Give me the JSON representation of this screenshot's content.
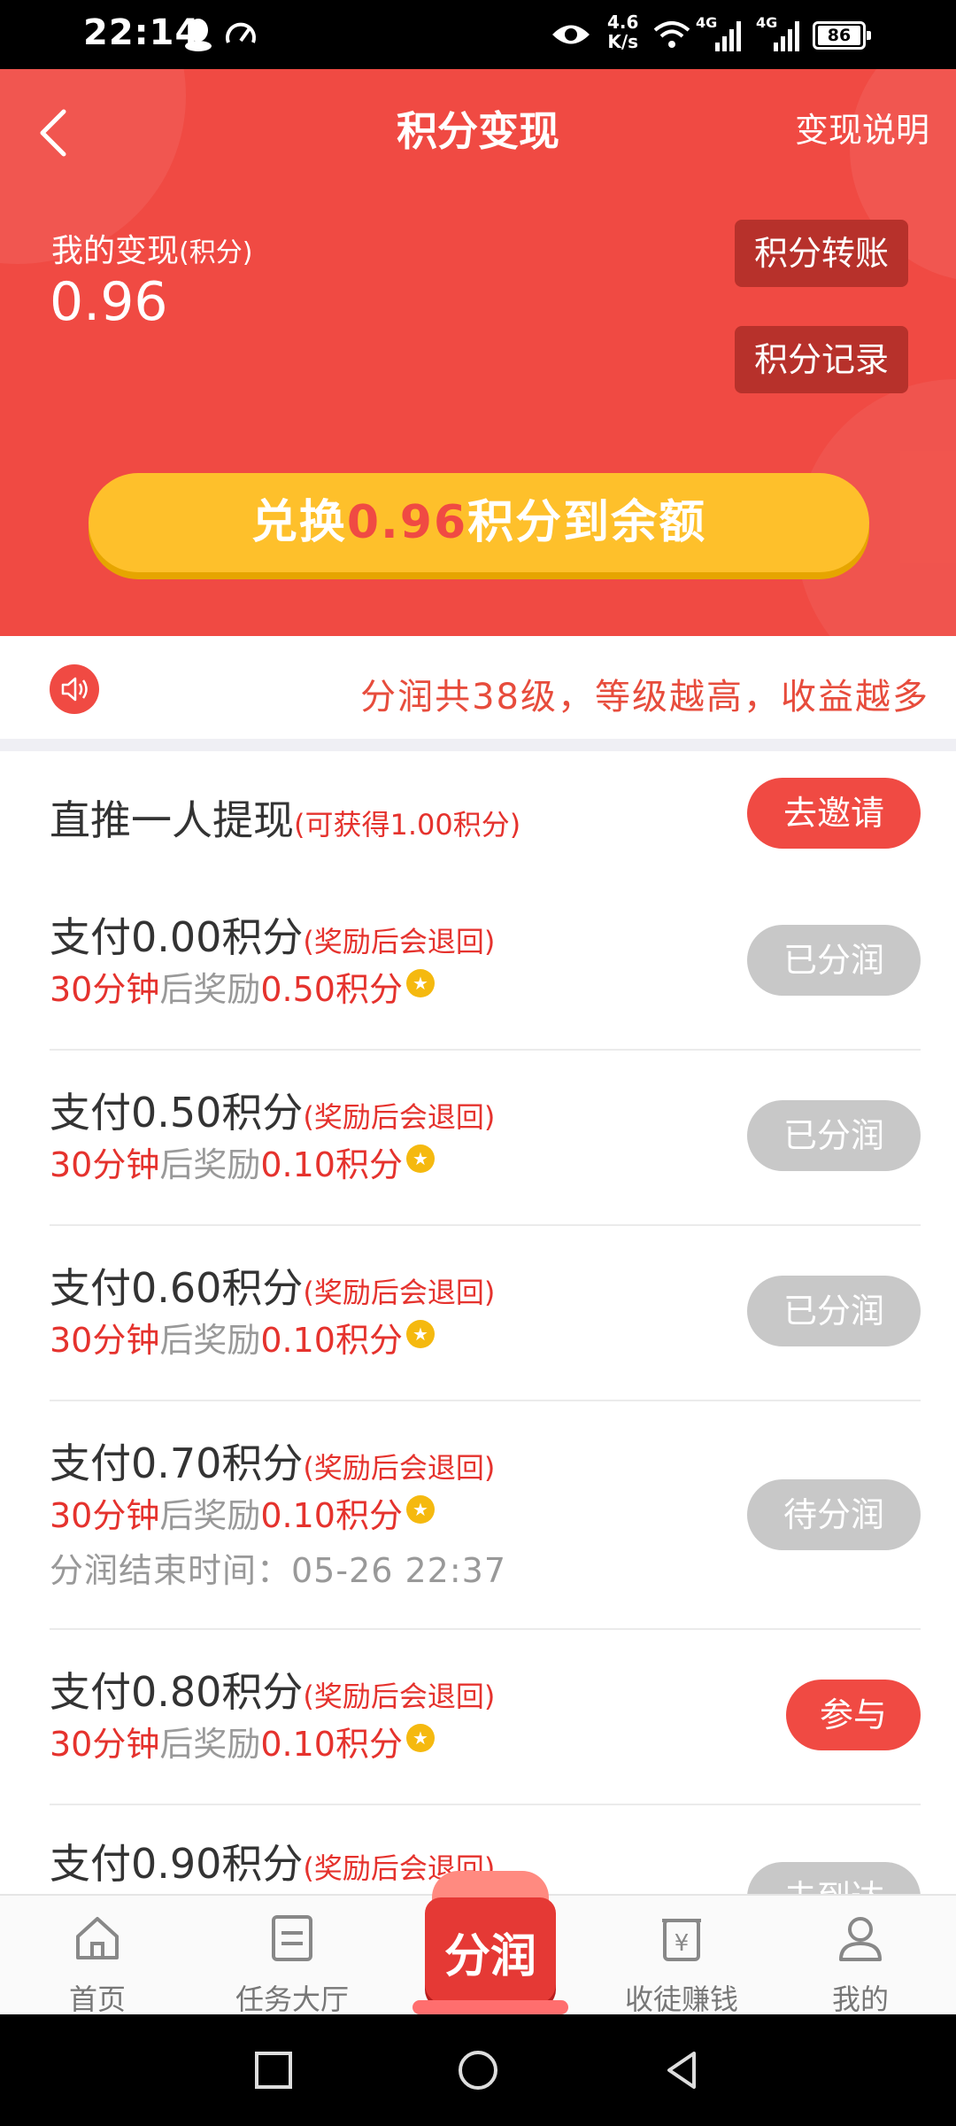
{
  "status_bar": {
    "time": "22:14",
    "net_speed_value": "4.6",
    "net_speed_unit": "K/s",
    "signal_1_label": "4G",
    "signal_2_label": "4G",
    "battery": "86"
  },
  "header": {
    "title": "积分变现",
    "help_link": "变现说明",
    "my_label": "我的变现",
    "my_label_unit": "(积分)",
    "my_value": "0.96",
    "transfer_button": "积分转账",
    "records_button": "积分记录",
    "exchange_prefix": "兑换",
    "exchange_amount": "0.96",
    "exchange_suffix": "积分到余额"
  },
  "notice": {
    "text": "分润共38级，等级越高，收益越多"
  },
  "tasks": [
    {
      "title": "直推一人提现",
      "note": "(可获得1.00积分)",
      "button": "去邀请"
    },
    {
      "title": "支付0.00积分",
      "note": "(奖励后会退回)",
      "sub_red1": "30分钟",
      "sub_gray": "后奖励",
      "sub_red2": "0.50积分",
      "button": "已分润"
    },
    {
      "title": "支付0.50积分",
      "note": "(奖励后会退回)",
      "sub_red1": "30分钟",
      "sub_gray": "后奖励",
      "sub_red2": "0.10积分",
      "button": "已分润"
    },
    {
      "title": "支付0.60积分",
      "note": "(奖励后会退回)",
      "sub_red1": "30分钟",
      "sub_gray": "后奖励",
      "sub_red2": "0.10积分",
      "button": "已分润"
    },
    {
      "title": "支付0.70积分",
      "note": "(奖励后会退回)",
      "sub_red1": "30分钟",
      "sub_gray": "后奖励",
      "sub_red2": "0.10积分",
      "end_time": "分润结束时间：05-26 22:37",
      "button": "待分润"
    },
    {
      "title": "支付0.80积分",
      "note": "(奖励后会退回)",
      "sub_red1": "30分钟",
      "sub_gray": "后奖励",
      "sub_red2": "0.10积分",
      "button": "参与"
    },
    {
      "title": "支付0.90积分",
      "note": "(奖励后会退回)",
      "button": "未到达"
    }
  ],
  "bottom_nav": {
    "home": "首页",
    "tasks": "任务大厅",
    "center": "分润",
    "recruit": "收徒赚钱",
    "mine": "我的"
  },
  "colors": {
    "brand_red": "#f04a43",
    "button_yellow": "#fec02b",
    "dark_red_button": "#b7312b",
    "text_red": "#e5322d",
    "disabled_gray": "#c8c8c8"
  }
}
